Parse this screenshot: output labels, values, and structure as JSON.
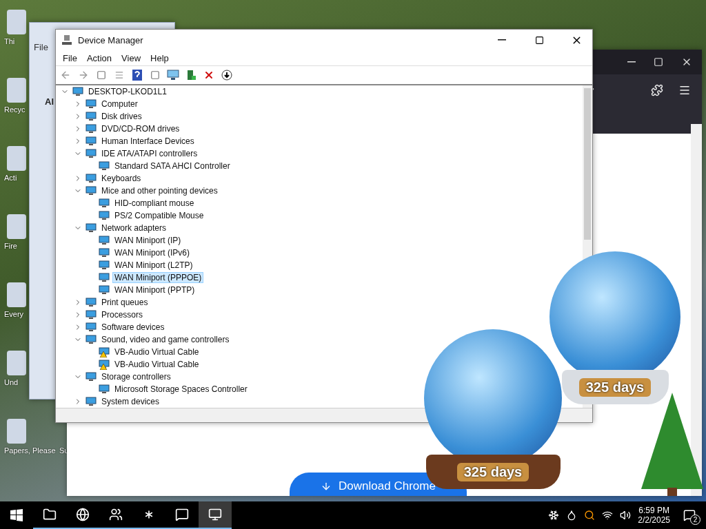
{
  "desktop_icons": [
    {
      "label": "Thi"
    },
    {
      "label": "Recyc"
    },
    {
      "label": "Acti"
    },
    {
      "label": "Fire"
    },
    {
      "label": "Every"
    },
    {
      "label": "Und"
    },
    {
      "label": "Papers, Please"
    },
    {
      "label": "Su"
    }
  ],
  "background_window": {
    "menu": [
      "File"
    ],
    "tab": "Al"
  },
  "browser": {
    "download_button": "Download Chrome"
  },
  "widgets": [
    {
      "label": "325 days"
    },
    {
      "label": "325 days"
    }
  ],
  "device_manager": {
    "title": "Device Manager",
    "menu": [
      "File",
      "Action",
      "View",
      "Help"
    ],
    "tree": {
      "label": "DESKTOP-LKOD1L1",
      "expanded": true,
      "selected": false,
      "children": [
        {
          "label": "Computer",
          "expanded": false,
          "selected": false
        },
        {
          "label": "Disk drives",
          "expanded": false,
          "selected": false
        },
        {
          "label": "DVD/CD-ROM drives",
          "expanded": false,
          "selected": false
        },
        {
          "label": "Human Interface Devices",
          "expanded": false,
          "selected": false
        },
        {
          "label": "IDE ATA/ATAPI controllers",
          "expanded": true,
          "selected": false,
          "children": [
            {
              "label": "Standard SATA AHCI Controller",
              "selected": false,
              "warning": false
            }
          ]
        },
        {
          "label": "Keyboards",
          "expanded": false,
          "selected": false
        },
        {
          "label": "Mice and other pointing devices",
          "expanded": true,
          "selected": false,
          "children": [
            {
              "label": "HID-compliant mouse",
              "selected": false,
              "warning": false
            },
            {
              "label": "PS/2 Compatible Mouse",
              "selected": false,
              "warning": false
            }
          ]
        },
        {
          "label": "Network adapters",
          "expanded": true,
          "selected": false,
          "children": [
            {
              "label": "WAN Miniport (IP)",
              "selected": false,
              "warning": false
            },
            {
              "label": "WAN Miniport (IPv6)",
              "selected": false,
              "warning": false
            },
            {
              "label": "WAN Miniport (L2TP)",
              "selected": false,
              "warning": false
            },
            {
              "label": "WAN Miniport (PPPOE)",
              "selected": true,
              "warning": false
            },
            {
              "label": "WAN Miniport (PPTP)",
              "selected": false,
              "warning": false
            }
          ]
        },
        {
          "label": "Print queues",
          "expanded": false,
          "selected": false
        },
        {
          "label": "Processors",
          "expanded": false,
          "selected": false
        },
        {
          "label": "Software devices",
          "expanded": false,
          "selected": false
        },
        {
          "label": "Sound, video and game controllers",
          "expanded": true,
          "selected": false,
          "children": [
            {
              "label": "VB-Audio Virtual Cable",
              "selected": false,
              "warning": true
            },
            {
              "label": "VB-Audio Virtual Cable",
              "selected": false,
              "warning": true
            }
          ]
        },
        {
          "label": "Storage controllers",
          "expanded": true,
          "selected": false,
          "children": [
            {
              "label": "Microsoft Storage Spaces Controller",
              "selected": false,
              "warning": false
            }
          ]
        },
        {
          "label": "System devices",
          "expanded": false,
          "selected": false
        }
      ]
    }
  },
  "taskbar": {
    "apps": [
      {
        "selected": false
      },
      {
        "selected": false
      },
      {
        "selected": false
      },
      {
        "selected": false
      },
      {
        "selected": false
      },
      {
        "selected": true
      }
    ],
    "time": "6:59 PM",
    "date": "2/2/2025",
    "notifications": "2"
  }
}
